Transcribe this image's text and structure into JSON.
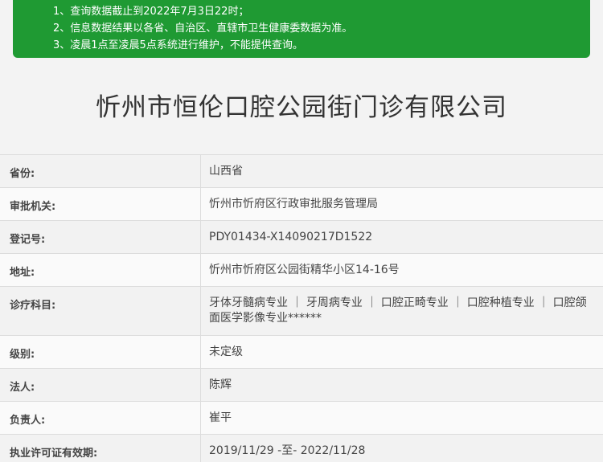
{
  "notice": {
    "lines": [
      "1、查询数据截止到2022年7月3日22时；",
      "2、信息数据结果以各省、自治区、直辖市卫生健康委数据为准。",
      "3、凌晨1点至凌晨5点系统进行维护，不能提供查询。"
    ]
  },
  "title": "忻州市恒伦口腔公园街门诊有限公司",
  "rows": [
    {
      "label": "省份:",
      "value": "山西省"
    },
    {
      "label": "审批机关:",
      "value": "忻州市忻府区行政审批服务管理局"
    },
    {
      "label": "登记号:",
      "value": "PDY01434-X14090217D1522"
    },
    {
      "label": "地址:",
      "value": "忻州市忻府区公园街精华小区14-16号"
    },
    {
      "label": "诊疗科目:",
      "value": "牙体牙髓病专业 ｜ 牙周病专业 ｜ 口腔正畸专业 ｜ 口腔种植专业 ｜ 口腔颌面医学影像专业******"
    },
    {
      "label": "级别:",
      "value": "未定级"
    },
    {
      "label": "法人:",
      "value": "陈辉"
    },
    {
      "label": "负责人:",
      "value": "崔平"
    },
    {
      "label": "执业许可证有效期:",
      "value": "2019/11/29 -至- 2022/11/28"
    }
  ]
}
